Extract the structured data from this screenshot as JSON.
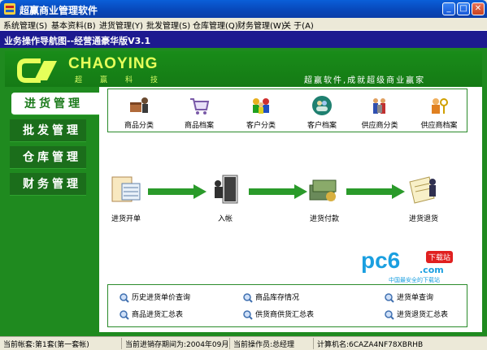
{
  "window": {
    "title": "超赢商业管理软件",
    "minimize": "_",
    "maximize": "□",
    "close": "✕"
  },
  "menu": [
    "系统管理(S)",
    "基本资料(B)",
    "进货管理(Y)",
    "批发管理(S)",
    "仓库管理(Q)",
    "财务管理(W)",
    "关 于(A)"
  ],
  "nav_header": "业务操作导航图--经营通豪华版V3.1",
  "banner": {
    "brand": "CHAOYING",
    "brand_sub": "超赢科技",
    "slogan": "超赢软件,成就超级商业赢家",
    "colors": {
      "brand": "#e6ff5a",
      "bg": "#198c19"
    }
  },
  "sidebar": [
    {
      "label": "进货管理",
      "active": true
    },
    {
      "label": "批发管理",
      "active": false
    },
    {
      "label": "仓库管理",
      "active": false
    },
    {
      "label": "财务管理",
      "active": false
    }
  ],
  "top_icons": [
    {
      "label": "商品分类",
      "icon": "box-cart-icon"
    },
    {
      "label": "商品档案",
      "icon": "cart-basket-icon"
    },
    {
      "label": "客户分类",
      "icon": "people-group-icon"
    },
    {
      "label": "客户档案",
      "icon": "person-record-icon"
    },
    {
      "label": "供应商分类",
      "icon": "supplier-group-icon"
    },
    {
      "label": "供应商档案",
      "icon": "key-person-icon"
    }
  ],
  "flow": [
    {
      "label": "进货开单",
      "icon": "invoice-icon"
    },
    {
      "label": "入帐",
      "icon": "door-entry-icon"
    },
    {
      "label": "进货付款",
      "icon": "money-icon"
    },
    {
      "label": "进货退货",
      "icon": "return-goods-icon"
    }
  ],
  "queries": [
    {
      "label": "历史进货单价查询"
    },
    {
      "label": "商品库存情况"
    },
    {
      "label": "进货单查询"
    },
    {
      "label": "商品进货汇总表"
    },
    {
      "label": "供货商供货汇总表"
    },
    {
      "label": "进货退货汇总表"
    }
  ],
  "watermark": {
    "logo": "pc6",
    "tag": "下载站",
    "domain": ".com",
    "slogan": "中国最安全的下载站"
  },
  "status": {
    "account": "当前帐套:第1套(第一套帐)",
    "period": "当前进销存期间为:2004年09月",
    "operator": "当前操作员:总经理",
    "machine": "计算机名:6CAZA4NF78XBRHB"
  }
}
